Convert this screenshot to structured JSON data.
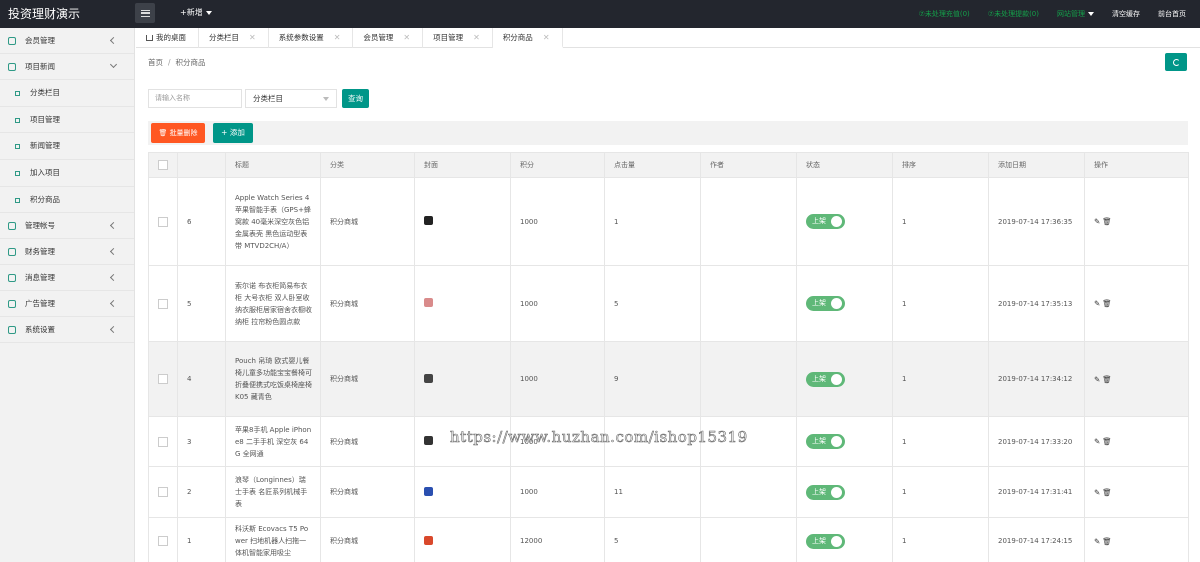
{
  "app": {
    "title": "投资理财演示"
  },
  "header": {
    "new_label": "+新增",
    "links": [
      {
        "label": "⑦未处理充值(0)",
        "color": "#14a04a"
      },
      {
        "label": "⑦未处理提款(0)",
        "color": "#14a04a"
      },
      {
        "label": "网站管理",
        "color": "#14a04a"
      },
      {
        "label": "清空缓存",
        "color": "#ffffff"
      },
      {
        "label": "前台首页",
        "color": "#ffffff"
      }
    ]
  },
  "sidebar": {
    "items": [
      {
        "label": "会员管理",
        "icon": "user-icon"
      },
      {
        "label": "项目新闻",
        "icon": "bus-icon",
        "expanded": true,
        "children": [
          "分类栏目",
          "项目管理",
          "新闻管理",
          "加入项目",
          "积分商品"
        ]
      },
      {
        "label": "管理帐号",
        "icon": "account-icon"
      },
      {
        "label": "财务管理",
        "icon": "finance-icon"
      },
      {
        "label": "消息管理",
        "icon": "message-icon"
      },
      {
        "label": "广告管理",
        "icon": "ad-icon"
      },
      {
        "label": "系统设置",
        "icon": "gear-icon"
      }
    ]
  },
  "tabs": [
    "我的桌面",
    "分类栏目",
    "系统参数设置",
    "会员管理",
    "项目管理",
    "积分商品"
  ],
  "breadcrumb": {
    "home": "首页",
    "sep": "/",
    "current": "积分商品"
  },
  "filter": {
    "placeholder": "请输入名称",
    "select_value": "分类栏目",
    "query_label": "查询"
  },
  "toolbar": {
    "batch_delete_label": "批量删除",
    "add_label": "添加"
  },
  "table": {
    "headers": [
      "标题",
      "分类",
      "封面",
      "积分",
      "点击量",
      "作者",
      "状态",
      "排序",
      "添加日期",
      "操作"
    ],
    "rows": [
      {
        "id": "6",
        "title": "Apple Watch Series 4 苹果智能手表（GPS+蜂窝款 40毫米深空灰色铝金属表壳 黑色运动型表带 MTVD2CH/A）",
        "category": "积分商城",
        "cover_color": "#222222",
        "points": "1000",
        "clicks": "1",
        "author": "",
        "status": "上架",
        "sort": "1",
        "date": "2019-07-14 17:36:35"
      },
      {
        "id": "5",
        "title": "索尔诺 布衣柜简易布衣柜 大号衣柜 双人卧室收纳衣服柜居家宿舍衣橱收纳柜 拉帘粉色圆点款",
        "category": "积分商城",
        "cover_color": "#d98b8b",
        "points": "1000",
        "clicks": "5",
        "author": "",
        "status": "上架",
        "sort": "1",
        "date": "2019-07-14 17:35:13"
      },
      {
        "id": "4",
        "title": "Pouch 帛琦 欧式婴儿餐椅儿童多功能宝宝餐椅可折叠便携式吃饭桌椅座椅K05 藏青色",
        "category": "积分商城",
        "cover_color": "#444444",
        "points": "1000",
        "clicks": "9",
        "author": "",
        "status": "上架",
        "sort": "1",
        "date": "2019-07-14 17:34:12"
      },
      {
        "id": "3",
        "title": "苹果8手机 Apple iPhone8 二手手机 深空灰 64G 全网通",
        "category": "积分商城",
        "cover_color": "#333333",
        "points": "1000",
        "clicks": "",
        "author": "",
        "status": "上架",
        "sort": "1",
        "date": "2019-07-14 17:33:20"
      },
      {
        "id": "2",
        "title": "浪琴（Longinnes）瑞士手表 名匠系列机械手表",
        "category": "积分商城",
        "cover_color": "#2a4fb0",
        "points": "1000",
        "clicks": "11",
        "author": "",
        "status": "上架",
        "sort": "1",
        "date": "2019-07-14 17:31:41"
      },
      {
        "id": "1",
        "title": "科沃斯 Ecovacs T5 Power 扫地机器人扫拖一体机智能家用吸尘",
        "category": "积分商城",
        "cover_color": "#d9482b",
        "points": "12000",
        "clicks": "5",
        "author": "",
        "status": "上架",
        "sort": "1",
        "date": "2019-07-14 17:24:15"
      }
    ]
  },
  "watermark": "https://www.huzhan.com/ishop15319",
  "colors": {
    "accent": "#009688",
    "danger": "#ff5722",
    "switch_on": "#5fb878",
    "topbar": "#23262e"
  }
}
